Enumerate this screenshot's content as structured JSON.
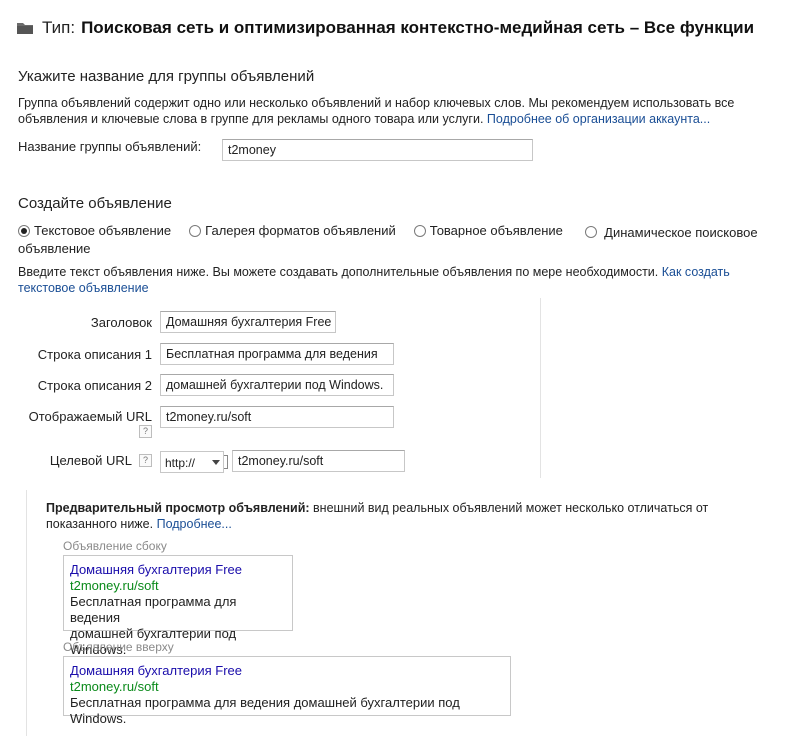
{
  "header": {
    "type_label": "Тип:",
    "type_value": "Поисковая сеть и оптимизированная контекстно-медийная сеть – Все функции"
  },
  "ad_group": {
    "section_title": "Укажите название для группы объявлений",
    "description": "Группа объявлений содержит одно или несколько объявлений и набор ключевых слов. Мы рекомендуем использовать все объявления и ключевые слова в группе для рекламы одного товара или услуги.",
    "learn_more_link": "Подробнее об организации аккаунта...",
    "name_label": "Название группы объявлений:",
    "name_value": "t2money"
  },
  "create_ad": {
    "section_title": "Создайте объявление",
    "ad_types": [
      {
        "label": "Текстовое объявление",
        "selected": true
      },
      {
        "label": "Галерея форматов объявлений",
        "selected": false
      },
      {
        "label": "Товарное объявление",
        "selected": false
      },
      {
        "label": "Динамическое поисковое объявление",
        "selected": false
      }
    ],
    "instruction": "Введите текст объявления ниже. Вы можете создавать дополнительные объявления по мере необходимости.",
    "instruction_link": "Как создать текстовое объявление"
  },
  "form": {
    "headline_label": "Заголовок",
    "headline_value": "Домашняя бухгалтерия Free",
    "desc1_label": "Строка описания 1",
    "desc1_value": "Бесплатная программа для ведения",
    "desc2_label": "Строка описания 2",
    "desc2_value": "домашней бухгалтерии под Windows.",
    "display_url_label": "Отображаемый URL",
    "display_url_value": "t2money.ru/soft",
    "dest_url_label": "Целевой URL",
    "protocol_value": "http://",
    "dest_url_value": "t2money.ru/soft",
    "help_glyph": "?"
  },
  "preview": {
    "title_bold": "Предварительный просмотр объявлений:",
    "title_rest": " внешний вид реальных объявлений может несколько отличаться от показанного ниже.",
    "more_link": "Подробнее...",
    "side_caption": "Объявление сбоку",
    "top_caption": "Объявление вверху",
    "ad_title": "Домашняя бухгалтерия Free",
    "ad_url": "t2money.ru/soft",
    "ad_line1": "Бесплатная программа для ведения",
    "ad_line2": "домашней бухгалтерии под Windows.",
    "ad_full_desc": "Бесплатная программа для ведения домашней бухгалтерии под Windows."
  },
  "colors": {
    "link": "#1a4e95",
    "ad_title": "#1a0dab",
    "ad_url": "#0a8a1a"
  },
  "icons": {
    "folder": "folder-icon",
    "help": "help-icon",
    "radio": "radio-button"
  }
}
